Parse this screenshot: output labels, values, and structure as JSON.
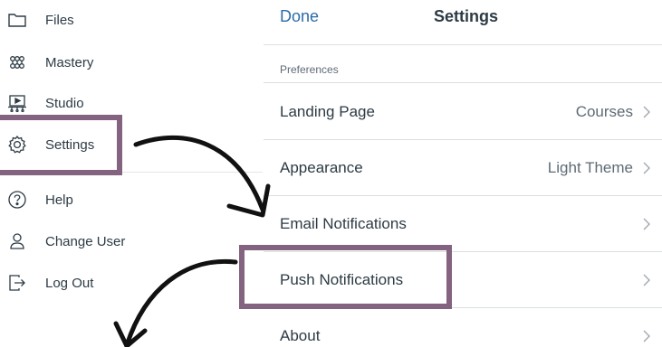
{
  "nav": {
    "items": [
      {
        "label": "Files",
        "icon": "folder-icon"
      },
      {
        "label": "Mastery",
        "icon": "mastery-icon"
      },
      {
        "label": "Studio",
        "icon": "studio-icon"
      },
      {
        "label": "Settings",
        "icon": "gear-icon"
      },
      {
        "label": "Help",
        "icon": "help-icon"
      },
      {
        "label": "Change User",
        "icon": "change-user-icon"
      },
      {
        "label": "Log Out",
        "icon": "log-out-icon"
      }
    ]
  },
  "settings": {
    "done_label": "Done",
    "title": "Settings",
    "section_label": "Preferences",
    "rows": [
      {
        "label": "Landing Page",
        "value": "Courses"
      },
      {
        "label": "Appearance",
        "value": "Light Theme"
      },
      {
        "label": "Email Notifications",
        "value": ""
      },
      {
        "label": "Push Notifications",
        "value": ""
      },
      {
        "label": "About",
        "value": ""
      }
    ]
  },
  "colors": {
    "highlight": "#83637f",
    "link": "#2b6ca8",
    "text": "#2d3b45",
    "muted": "#5f6b75",
    "divider": "#dcdfe2"
  }
}
